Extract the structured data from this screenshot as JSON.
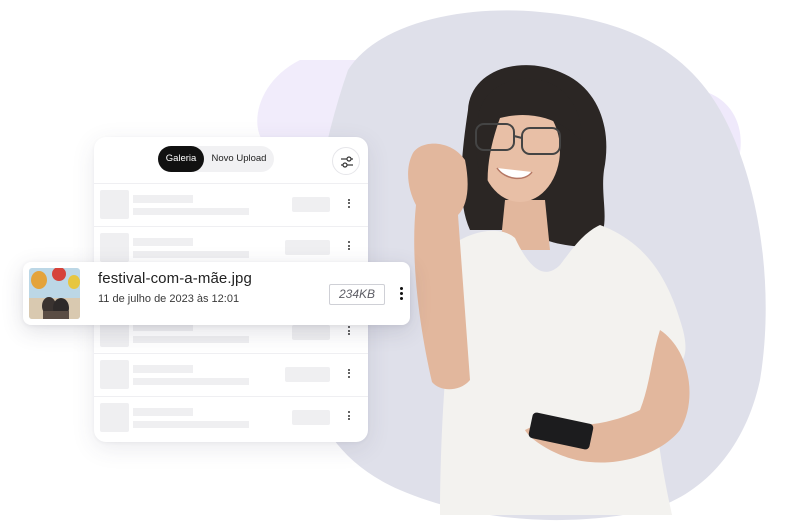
{
  "tabs": {
    "gallery": "Galeria",
    "new_upload": "Novo Upload",
    "active": "Galeria"
  },
  "icons": {
    "filter": "sliders-filter-icon",
    "more": "more-vertical-icon",
    "thumbnail": "hot-air-balloon-photo"
  },
  "placeholder_rows_count_visible": 6,
  "file": {
    "name": "festival-com-a-mãe.jpg",
    "date": "11 de julho de 2023 às 12:01",
    "size": "234KB"
  },
  "colors": {
    "active_tab_bg": "#111111",
    "background_blob": "#dfe0ea",
    "accent_blob": "#eee8fb",
    "placeholder": "#efeff1"
  }
}
